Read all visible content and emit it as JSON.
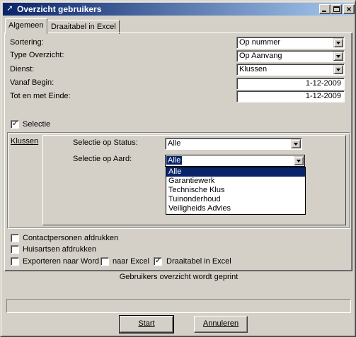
{
  "window": {
    "title": "Overzicht gebruikers",
    "icon": "app-arrow-icon",
    "controls": {
      "minimize_icon": "minimize-icon",
      "maximize_icon": "maximize-icon",
      "close_icon": "close-icon",
      "close_glyph": "×"
    }
  },
  "tabs": [
    {
      "label": "Algemeen",
      "active": true
    },
    {
      "label": "Draaitabel in Excel",
      "active": false
    }
  ],
  "form": {
    "sortering": {
      "label": "Sortering:",
      "value": "Op nummer"
    },
    "type_overzicht": {
      "label": "Type Overzicht:",
      "value": "Op Aanvang"
    },
    "dienst": {
      "label": "Dienst:",
      "value": "Klussen"
    },
    "vanaf_begin": {
      "label": "Vanaf Begin:",
      "value": "1-12-2009"
    },
    "tot_en_met_einde": {
      "label": "Tot en met Einde:",
      "value": "1-12-2009"
    }
  },
  "selectie": {
    "checkbox_label": "Selectie",
    "checked": true,
    "check_glyph": "✓",
    "inner_tab": "Klussen",
    "status": {
      "label": "Selectie op Status:",
      "value": "Alle"
    },
    "aard": {
      "label": "Selectie op Aard:",
      "value": "Alle",
      "options": [
        "Alle",
        "Garantiewerk",
        "Technische Klus",
        "Tuinonderhoud",
        "Veiligheids Advies"
      ],
      "selected_index": 0
    }
  },
  "options": {
    "contactpersonen": {
      "label": "Contactpersonen afdrukken",
      "checked": false
    },
    "huisartsen": {
      "label": "Huisartsen afdrukken",
      "checked": false
    },
    "word": {
      "label": "Exporteren naar Word",
      "checked": false
    },
    "excel": {
      "label": "naar Excel",
      "checked": false
    },
    "draaitabel": {
      "label": "Draaitabel in Excel",
      "checked": true
    }
  },
  "status_text": "Gebruikers overzicht wordt geprint",
  "progress": {
    "value": 0
  },
  "buttons": {
    "start": "Start",
    "annuleren": "Annuleren"
  },
  "colors": {
    "titlebar_start": "#0a246a",
    "titlebar_end": "#a6caf0",
    "selection": "#0a246a",
    "face": "#d4d0c8"
  }
}
